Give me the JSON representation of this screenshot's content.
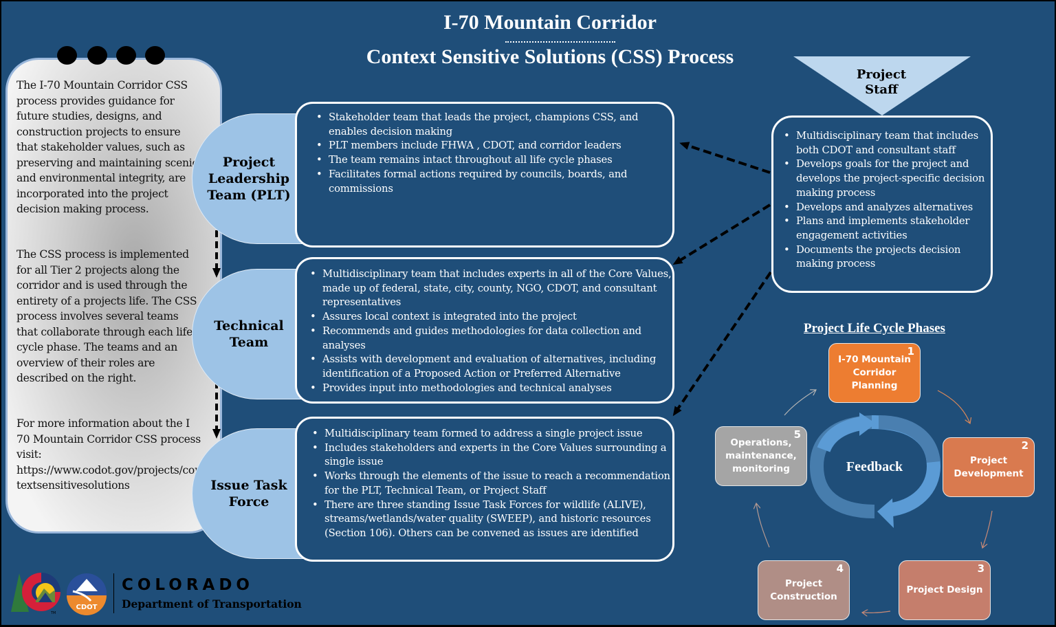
{
  "header": {
    "title_line1": "I-70 Mountain Corridor",
    "title_line2": "Context Sensitive Solutions (CSS) Process"
  },
  "intro_note": {
    "paragraph1": "The I-70 Mountain Corridor CSS process provides guidance for future studies, designs, and construction projects to ensure that stakeholder values, such as preserving and maintaining scenic and environmental integrity, are incorporated into the project decision making process.",
    "paragraph2": "The CSS process is implemented for all Tier 2 projects along the corridor and is used through the entirety of a projects life. The CSS process involves several teams that collaborate through each life cycle phase. The teams and an overview of their roles are described on the right.",
    "paragraph3": "For more information about the I 70 Mountain Corridor CSS process visit: https://www.codot.gov/projects/contextsensitivesolutions"
  },
  "teams": [
    {
      "name": "Project Leadership Team (PLT)",
      "bullets": [
        "Stakeholder team that leads the project, champions CSS, and enables decision making",
        "PLT members include FHWA , CDOT, and corridor leaders",
        "The team remains intact throughout all life cycle phases",
        "Facilitates formal actions required by councils, boards, and commissions"
      ]
    },
    {
      "name": "Technical Team",
      "bullets": [
        "Multidisciplinary team that includes experts in all of the Core Values, made up of federal, state, city, county, NGO, CDOT, and consultant representatives",
        "Assures  local context is integrated into the project",
        "Recommends  and guides methodologies  for data collection and analyses",
        "Assists  with development  and evaluation of alternatives, including identification of a Proposed  Action  or Preferred  Alternative",
        "Provides  input into methodologies  and technical analyses"
      ]
    },
    {
      "name": "Issue Task Force",
      "bullets": [
        "Multidisciplinary team formed to address a single project issue",
        "Includes stakeholders  and experts in the Core Values surrounding a single issue",
        "Works through the elements  of the issue to reach a recommendation  for the PLT, Technical Team, or Project Staff",
        "There are three standing Issue Task Forces  for wildlife (ALIVE), streams/wetlands/water  quality (SWEEP),  and historic resources (Section 106).  Others can be convened  as issues  are identified"
      ]
    }
  ],
  "project_staff": {
    "label": "Project Staff",
    "bullets": [
      "Multidisciplinary team that includes both CDOT and consultant staff",
      "Develops  goals for the project and develops  the project-specific decision  making process",
      "Develops  and analyzes  alternatives",
      "Plans and implements stakeholder engagement activities",
      "Documents  the projects decision making process"
    ]
  },
  "life_cycle": {
    "title": "Project Life Cycle Phases",
    "center_label": "Feedback",
    "phases": [
      {
        "number": "1",
        "label": "I-70 Mountain Corridor Planning",
        "color": "#ed7d31"
      },
      {
        "number": "2",
        "label": "Project Development",
        "color": "#d97a4f"
      },
      {
        "number": "3",
        "label": "Project Design",
        "color": "#c57e6c"
      },
      {
        "number": "4",
        "label": "Project Construction",
        "color": "#b08e86"
      },
      {
        "number": "5",
        "label": "Operations, maintenance, monitoring",
        "color": "#a5a5a5"
      }
    ]
  },
  "logo": {
    "state": "COLORADO",
    "department": "Department of Transportation",
    "badge": "CDOT",
    "trademark": "TM"
  },
  "colors": {
    "background": "#1f4e79",
    "team_pill": "#9dc3e6",
    "staff_triangle": "#bdd7ee",
    "feedback_arrow": "#5b9bd5"
  }
}
